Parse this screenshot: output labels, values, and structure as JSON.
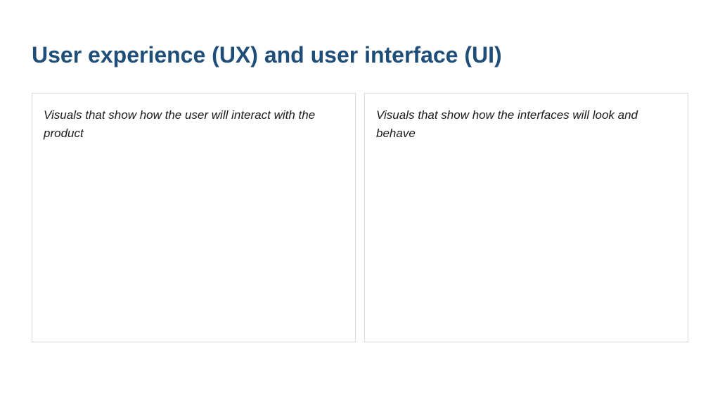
{
  "title": "User experience (UX) and user interface (UI)",
  "panels": {
    "left": {
      "text": "Visuals that show how the user will interact with the product"
    },
    "right": {
      "text": "Visuals that show how the interfaces will look and behave"
    }
  }
}
